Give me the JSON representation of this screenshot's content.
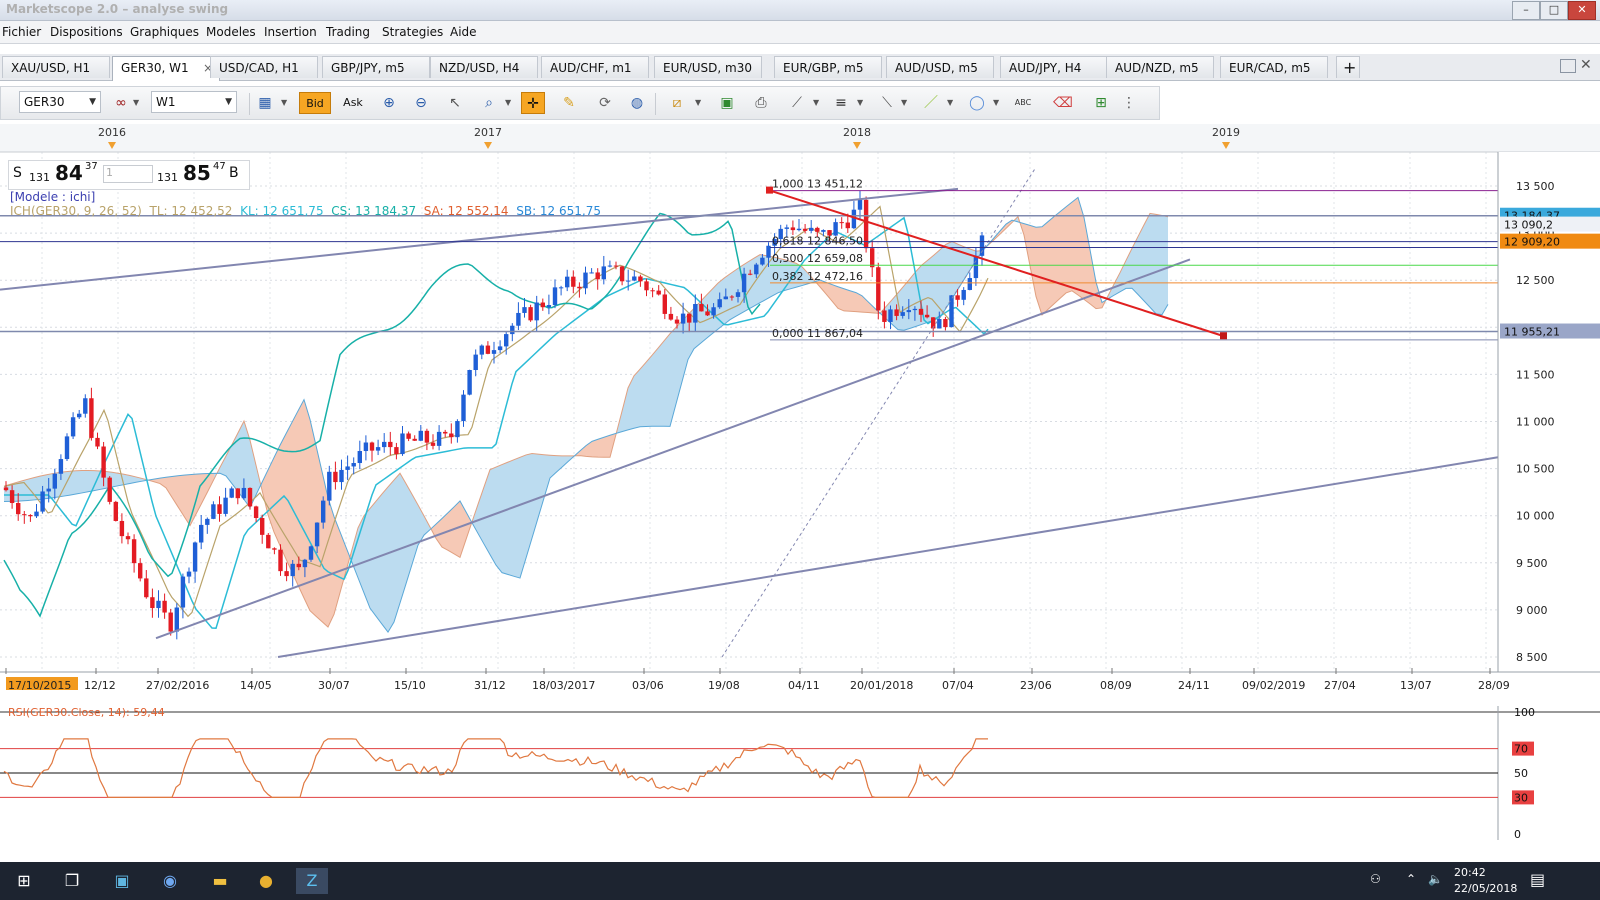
{
  "window": {
    "title": "Marketscope 2.0 – analyse swing",
    "minimize": "–",
    "maximize": "□",
    "close": "✕"
  },
  "menu": [
    "Fichier",
    "Dispositions",
    "Graphiques",
    "Modeles",
    "Insertion",
    "Trading",
    "Strategies",
    "Aide"
  ],
  "tabs": [
    {
      "label": "XAU/USD, H1"
    },
    {
      "label": "GER30, W1",
      "active": true,
      "close": "×"
    },
    {
      "label": "USD/CAD, H1"
    },
    {
      "label": "GBP/JPY, m5"
    },
    {
      "label": "NZD/USD, H4"
    },
    {
      "label": "AUD/CHF, m1"
    },
    {
      "label": "EUR/USD, m30"
    },
    {
      "label": "EUR/GBP, m5"
    },
    {
      "label": "AUD/USD, m5"
    },
    {
      "label": "AUD/JPY, H4"
    },
    {
      "label": "AUD/NZD, m5"
    },
    {
      "label": "EUR/CAD, m5"
    }
  ],
  "add_tab": "+",
  "toolbar": {
    "symbol": "GER30",
    "timeframe": "W1",
    "bid": "Bid",
    "ask": "Ask",
    "abc": "ABC"
  },
  "quote": {
    "sell_label": "S",
    "sell_big": "131",
    "sell_main": "84",
    "sell_small": "37",
    "qty": "1",
    "buy_big": "131",
    "buy_main": "85",
    "buy_small": "47",
    "buy_label": "B"
  },
  "indicator": {
    "model": "[Modele : ichi]",
    "ich": "ICH(GER30, 9, 26, 52)",
    "tl": "TL: 12 452,52",
    "kl": "KL: 12 651,75",
    "cs": "CS: 13 184,37",
    "sa": "SA: 12 552,14",
    "sb": "SB: 12 651,75"
  },
  "fib": [
    {
      "level": "1,000",
      "value": "13 451,12"
    },
    {
      "level": "0,618",
      "value": "12 846,50"
    },
    {
      "level": "0,500",
      "value": "12 659,08"
    },
    {
      "level": "0,382",
      "value": "12 472,16"
    },
    {
      "level": "0,000",
      "value": "11 867,04"
    }
  ],
  "price_axis": [
    "13 500",
    "13 000",
    "12 500",
    "12 000",
    "11 500",
    "11 000",
    "10 500",
    "10 000",
    "9 500",
    "9 000",
    "8 500"
  ],
  "price_tags": [
    {
      "text": "13 184,37",
      "color": "#3aa9dc"
    },
    {
      "text": "13 090,2",
      "color": "#eef1f6"
    },
    {
      "text": "12 909,20",
      "color": "#f08a12"
    },
    {
      "text": "11 955,21",
      "color": "#9aa6c8"
    }
  ],
  "year_labels": [
    "2016",
    "2017",
    "2018",
    "2019"
  ],
  "date_labels": [
    "17/10/2015",
    "12/12",
    "27/02/2016",
    "14/05",
    "30/07",
    "15/10",
    "31/12",
    "18/03/2017",
    "03/06",
    "19/08",
    "04/11",
    "20/01/2018",
    "07/04",
    "23/06",
    "08/09",
    "24/11",
    "09/02/2019",
    "27/04",
    "13/07",
    "28/09"
  ],
  "rsi": {
    "label": "RSI(GER30.Close, 14): 59,44",
    "levels": [
      "100",
      "70",
      "50",
      "30",
      "0"
    ]
  },
  "taskbar": {
    "time": "20:42",
    "date": "22/05/2018"
  },
  "colors": {
    "up": "#1f5fd6",
    "down": "#e31b23",
    "kumo_bull": "#bcdcf0",
    "kumo_bear": "#f6c9b6",
    "tenkan": "#b9a36a",
    "kijun": "#2cbcd6",
    "chikou": "#17b0a8",
    "trend": "#e02020",
    "channel": "#8286b0",
    "rsi": "#e07840"
  }
}
